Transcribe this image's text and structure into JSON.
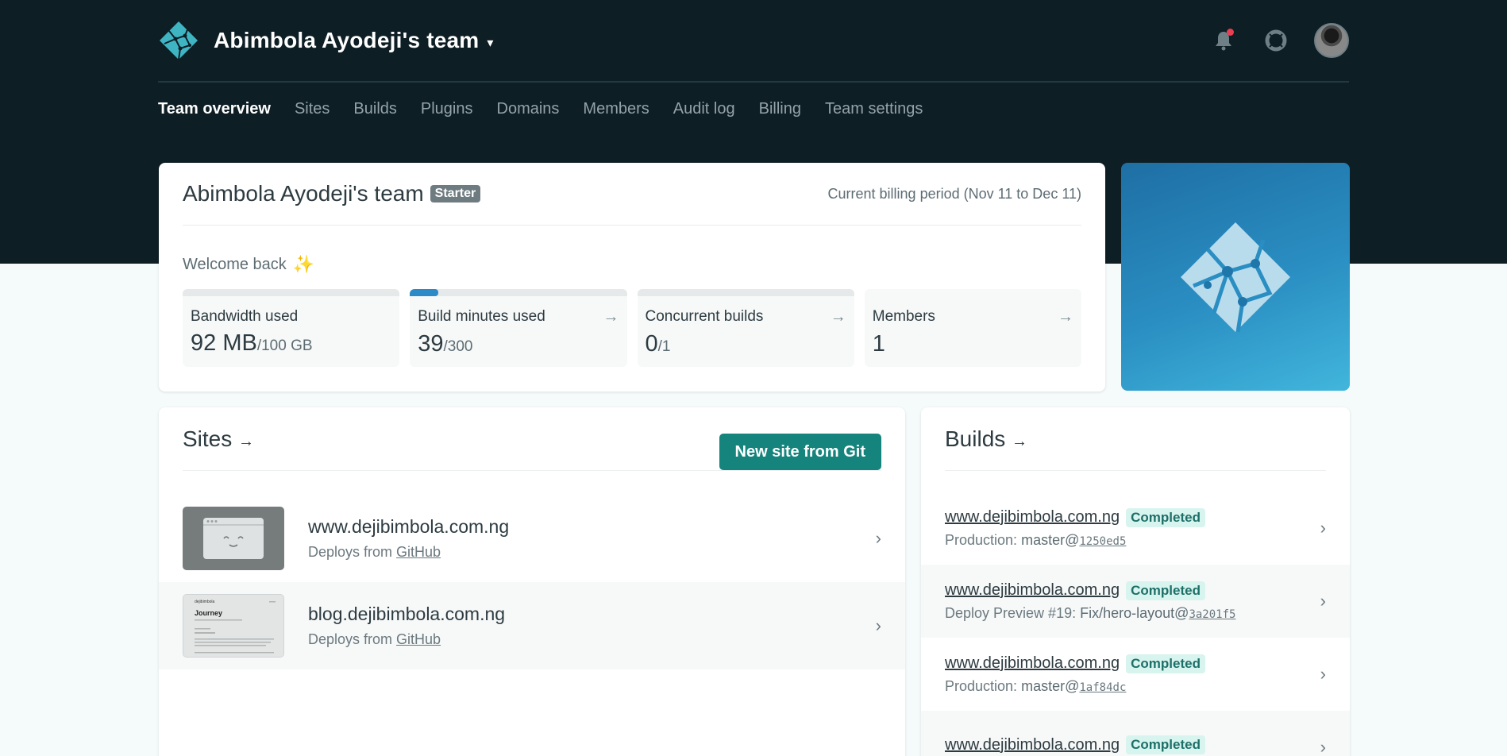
{
  "header": {
    "team_name": "Abimbola Ayodeji's team",
    "icons": [
      "netlify-logo-icon",
      "bell-icon",
      "support-icon",
      "avatar"
    ]
  },
  "nav": {
    "items": [
      {
        "label": "Team overview"
      },
      {
        "label": "Sites"
      },
      {
        "label": "Builds"
      },
      {
        "label": "Plugins"
      },
      {
        "label": "Domains"
      },
      {
        "label": "Members"
      },
      {
        "label": "Audit log"
      },
      {
        "label": "Billing"
      },
      {
        "label": "Team settings"
      }
    ]
  },
  "overview": {
    "title": "Abimbola Ayodeji's team",
    "plan": "Starter",
    "billing_period": "Current billing period (Nov 11 to Dec 11)",
    "welcome": "Welcome back",
    "stats": [
      {
        "label": "Bandwidth used",
        "value": "92 MB",
        "limit": "/100 GB",
        "arrow": "",
        "fill": 0.0009
      },
      {
        "label": "Build minutes used",
        "value": "39",
        "limit": "/300",
        "arrow": "→",
        "fill": 0.13
      },
      {
        "label": "Concurrent builds",
        "value": "0",
        "limit": "/1",
        "arrow": "→",
        "fill": 0
      },
      {
        "label": "Members",
        "value": "1",
        "limit": "",
        "arrow": "→"
      }
    ]
  },
  "sites": {
    "title": "Sites",
    "arrow": "→",
    "new_site_button": "New site from Git",
    "items": [
      {
        "name": "www.dejibimbola.com.ng",
        "deploys_prefix": "Deploys from ",
        "provider": "GitHub"
      },
      {
        "name": "blog.dejibimbola.com.ng",
        "deploys_prefix": "Deploys from ",
        "provider": "GitHub"
      }
    ],
    "thumb_text": {
      "brand": "dejibimbola",
      "heading": "Journey"
    }
  },
  "builds": {
    "title": "Builds",
    "arrow": "→",
    "items": [
      {
        "site": "www.dejibimbola.com.ng",
        "status": "Completed",
        "context": "Production:",
        "ref": "master@",
        "sha": "1250ed5"
      },
      {
        "site": "www.dejibimbola.com.ng",
        "status": "Completed",
        "context": "Deploy Preview #19:",
        "ref": "Fix/hero-layout@",
        "sha": "3a201f5"
      },
      {
        "site": "www.dejibimbola.com.ng",
        "status": "Completed",
        "context": "Production:",
        "ref": "master@",
        "sha": "1af84dc"
      },
      {
        "site": "www.dejibimbola.com.ng",
        "status": "Completed",
        "context": "",
        "ref": "",
        "sha": ""
      }
    ]
  },
  "colors": {
    "header_bg": "#0e1e25",
    "primary_button": "#15847d",
    "progress": "#2c8bc7",
    "notification": "#e93f52"
  }
}
